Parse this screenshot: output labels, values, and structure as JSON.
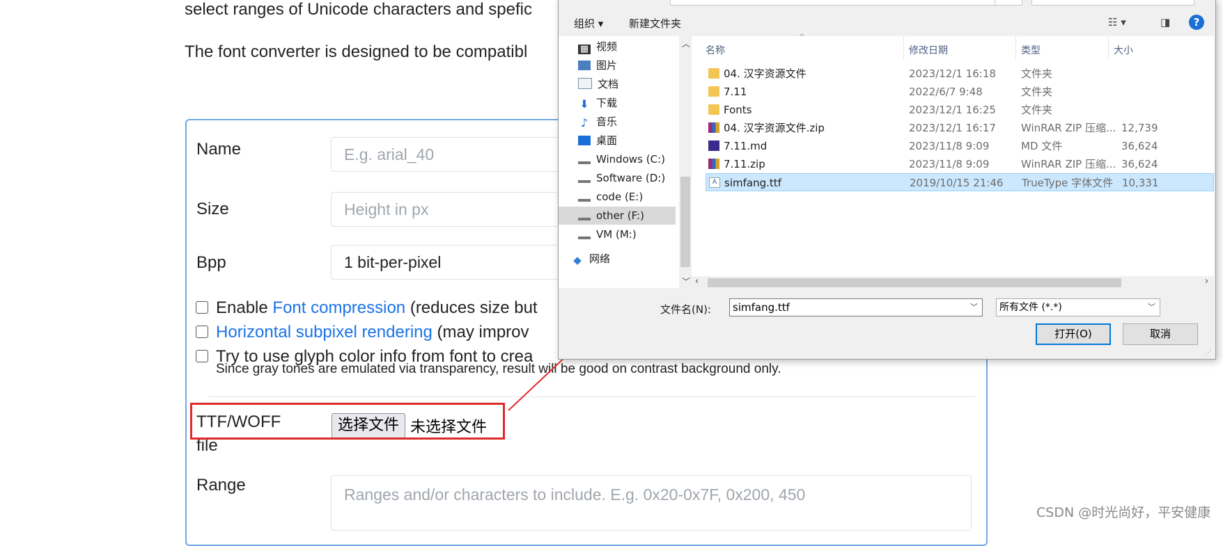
{
  "page": {
    "intro_line1": "select ranges of Unicode characters and spefic",
    "intro_line2": "The font converter is designed to be compatibl",
    "form": {
      "name_label": "Name",
      "name_placeholder": "E.g. arial_40",
      "size_label": "Size",
      "size_placeholder": "Height in px",
      "bpp_label": "Bpp",
      "bpp_value": "1 bit-per-pixel",
      "opt1_prefix": "Enable ",
      "opt1_link": "Font compression",
      "opt1_suffix": " (reduces size but",
      "opt2_link": "Horizontal subpixel rendering",
      "opt2_suffix": " (may improv",
      "opt3_text": "Try to use glyph color info from font to crea",
      "hint": "Since gray tones are emulated via transparency, result will be good on contrast background only.",
      "file_label_1": "TTF/WOFF",
      "file_label_2": "file",
      "file_button": "选择文件",
      "file_status": "未选择文件",
      "range_label": "Range",
      "range_placeholder": "Ranges and/or characters to include. E.g. 0x20-0x7F, 0x200, 450"
    },
    "watermark": "CSDN @时光尚好，平安健康"
  },
  "dialog": {
    "toolbar": {
      "organize": "组织 ▾",
      "new_folder": "新建文件夹",
      "help": "?"
    },
    "nav": [
      {
        "label": "视频",
        "icon": "video-icon"
      },
      {
        "label": "图片",
        "icon": "picture-icon"
      },
      {
        "label": "文档",
        "icon": "document-icon"
      },
      {
        "label": "下载",
        "icon": "download-icon"
      },
      {
        "label": "音乐",
        "icon": "music-icon"
      },
      {
        "label": "桌面",
        "icon": "desktop-icon"
      },
      {
        "label": "Windows (C:)",
        "icon": "drive-icon"
      },
      {
        "label": "Software (D:)",
        "icon": "drive-icon"
      },
      {
        "label": "code (E:)",
        "icon": "drive-icon"
      },
      {
        "label": "other (F:)",
        "icon": "drive-icon",
        "selected": true
      },
      {
        "label": "VM (M:)",
        "icon": "drive-icon"
      },
      {
        "label": "网络",
        "icon": "network-icon"
      }
    ],
    "columns": {
      "name": "名称",
      "date": "修改日期",
      "type": "类型",
      "size": "大小"
    },
    "files": [
      {
        "name": "04. 汉字资源文件",
        "date": "2023/12/1 16:18",
        "type": "文件夹",
        "size": "",
        "icon": "folder-icon"
      },
      {
        "name": "7.11",
        "date": "2022/6/7 9:48",
        "type": "文件夹",
        "size": "",
        "icon": "folder-icon"
      },
      {
        "name": "Fonts",
        "date": "2023/12/1 16:25",
        "type": "文件夹",
        "size": "",
        "icon": "folder-icon"
      },
      {
        "name": "04. 汉字资源文件.zip",
        "date": "2023/12/1 16:17",
        "type": "WinRAR ZIP 压缩...",
        "size": "12,739",
        "icon": "zip-icon"
      },
      {
        "name": "7.11.md",
        "date": "2023/11/8 9:09",
        "type": "MD 文件",
        "size": "36,624",
        "icon": "md-icon"
      },
      {
        "name": "7.11.zip",
        "date": "2023/11/8 9:09",
        "type": "WinRAR ZIP 压缩...",
        "size": "36,624",
        "icon": "zip-icon"
      },
      {
        "name": "simfang.ttf",
        "date": "2019/10/15 21:46",
        "type": "TrueType 字体文件",
        "size": "10,331",
        "icon": "ttf-icon",
        "selected": true
      }
    ],
    "filename_label": "文件名(N):",
    "filename_value": "simfang.ttf",
    "filetype_value": "所有文件 (*.*)",
    "open_button": "打开(O)",
    "cancel_button": "取消"
  },
  "colors": {
    "link": "#1a73e8",
    "annotation": "#e02a2a",
    "selection": "#cce8ff",
    "accent": "#0078d7"
  }
}
